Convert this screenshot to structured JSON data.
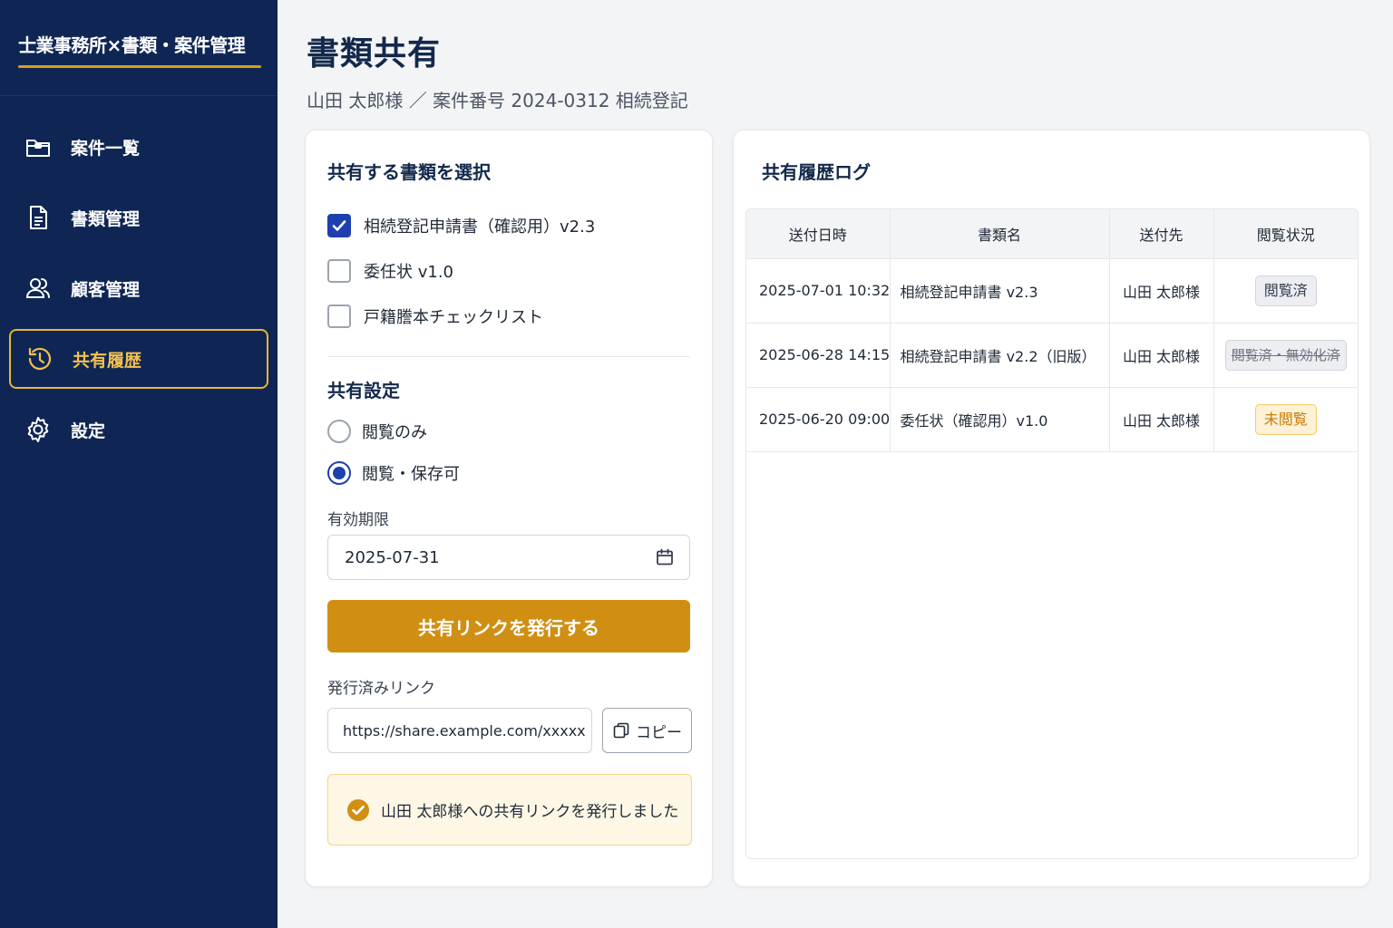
{
  "app": {
    "title": "士業事務所×書類・案件管理"
  },
  "sidebar": {
    "items": [
      {
        "label": "案件一覧",
        "icon": "folder-icon"
      },
      {
        "label": "書類管理",
        "icon": "document-icon"
      },
      {
        "label": "顧客管理",
        "icon": "users-icon"
      },
      {
        "label": "共有履歴",
        "icon": "history-icon",
        "active": true
      },
      {
        "label": "設定",
        "icon": "gear-icon"
      }
    ]
  },
  "header": {
    "title": "書類共有",
    "breadcrumb": "山田 太郎様 ／ 案件番号 2024-0312 相続登記"
  },
  "share_panel": {
    "title": "共有する書類を選択",
    "documents": [
      {
        "label": "相続登記申請書（確認用）v2.3",
        "checked": true
      },
      {
        "label": "委任状 v1.0",
        "checked": false
      },
      {
        "label": "戸籍謄本チェックリスト",
        "checked": false
      }
    ],
    "settings_title": "共有設定",
    "permissions": [
      {
        "label": "閲覧のみ",
        "selected": false
      },
      {
        "label": "閲覧・保存可",
        "selected": true
      }
    ],
    "expiry_label": "有効期限",
    "expiry_value": "2025-07-31",
    "issue_button": "共有リンクを発行する",
    "issued_label": "発行済みリンク",
    "issued_link": "https://share.example.com/xxxxx",
    "copy_button": "コピー",
    "notice": "山田 太郎様への共有リンクを発行しました"
  },
  "log_panel": {
    "title": "共有履歴ログ",
    "columns": [
      "送付日時",
      "書類名",
      "送付先",
      "閲覧状況"
    ],
    "rows": [
      {
        "date": "2025-07-01 10:32",
        "doc": "相続登記申請書 v2.3",
        "to": "山田 太郎様",
        "status": "閲覧済",
        "status_type": "viewed"
      },
      {
        "date": "2025-06-28 14:15",
        "doc": "相続登記申請書 v2.2（旧版）",
        "to": "山田 太郎様",
        "status": "閲覧済・無効化済",
        "status_type": "revoked"
      },
      {
        "date": "2025-06-20 09:00",
        "doc": "委任状（確認用）v1.0",
        "to": "山田 太郎様",
        "status": "未閲覧",
        "status_type": "unread"
      }
    ]
  },
  "colors": {
    "sidebar_bg": "#0f2654",
    "accent_gold": "#d08f13",
    "primary_blue": "#1e40af",
    "title_navy": "#13294b"
  }
}
